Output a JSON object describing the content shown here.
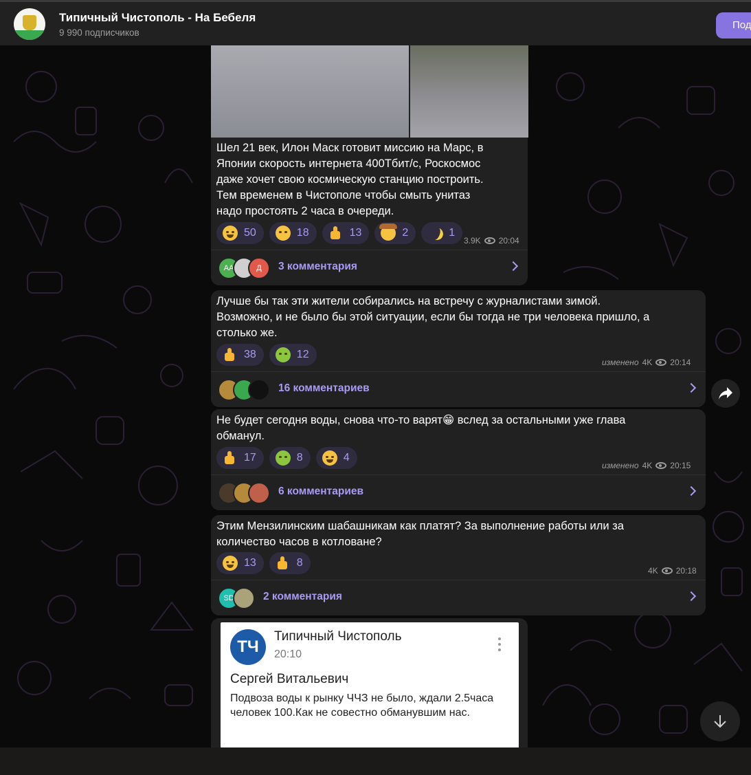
{
  "channel": {
    "title": "Типичный Чистополь - На Бебеля",
    "subscribers": "9 990 подписчиков",
    "join_label": "Под"
  },
  "messages": [
    {
      "text": "Шел 21 век, Илон Маск готовит миссию на Марс, в\nЯпонии скорость интернета 400Тбит/с, Роскосмос\nдаже хочет свою космическую станцию построить.\nТем временем в Чистополе чтобы смыть унитаз\nнадо простоять 2 часа в очереди.",
      "reactions": [
        {
          "emoji": "rolling-laughing-emoji",
          "count": "50"
        },
        {
          "emoji": "crying-emoji",
          "count": "18"
        },
        {
          "emoji": "thumbs-up-emoji",
          "count": "13"
        },
        {
          "emoji": "cowboy-emoji",
          "count": "2"
        },
        {
          "emoji": "banana-emoji",
          "count": "1"
        }
      ],
      "views": "3.9K",
      "time": "20:04",
      "comments": "3 комментария",
      "avatar_initials": [
        "АА",
        "",
        "Д"
      ]
    },
    {
      "text": "Лучше бы так эти жители собирались на встречу с журналистами зимой.\nВозможно, и не было бы этой ситуации, если бы тогда не три человека пришло, а\nстолько же.",
      "reactions": [
        {
          "emoji": "thumbs-up-emoji",
          "count": "38"
        },
        {
          "emoji": "vomit-emoji",
          "count": "12"
        }
      ],
      "edited": "изменено",
      "views": "4K",
      "time": "20:14",
      "comments": "16 комментариев"
    },
    {
      "text": "Не будет сегодня воды, снова что-то варят😁 вслед за остальными уже глава\nобманул.",
      "reactions": [
        {
          "emoji": "thumbs-up-emoji",
          "count": "17"
        },
        {
          "emoji": "vomit-emoji",
          "count": "8"
        },
        {
          "emoji": "rolling-laughing-emoji",
          "count": "4"
        }
      ],
      "edited": "изменено",
      "views": "4K",
      "time": "20:15",
      "comments": "6 комментариев"
    },
    {
      "text": "Этим Мензилинским шабашникам как платят? За выполнение работы или за\nколичество часов в котловане?",
      "reactions": [
        {
          "emoji": "rolling-laughing-emoji",
          "count": "13"
        },
        {
          "emoji": "thumbs-up-emoji",
          "count": "8"
        }
      ],
      "views": "4K",
      "time": "20:18",
      "comments": "2 комментария",
      "avatar_initials": [
        "SD",
        ""
      ]
    }
  ],
  "card": {
    "logo": "ТЧ",
    "name": "Типичный Чистополь",
    "time": "20:10",
    "author": "Сергей Витальевич",
    "text": "Подвоза воды к рынку ЧЧЗ не было, ждали 2.5часа человек 100.Как не совестно обманувшим нас."
  },
  "colors": {
    "accent": "#8774e1",
    "bubble": "#212121",
    "reaction_bg": "#2f2c40",
    "link": "#a89bf2"
  }
}
